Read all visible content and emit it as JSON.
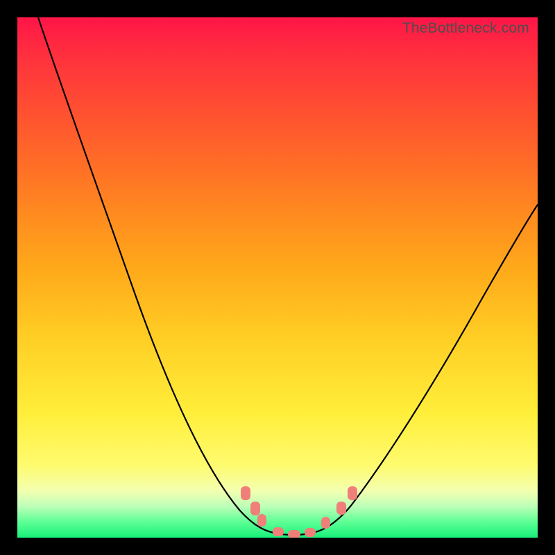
{
  "watermark": "TheBottleneck.com",
  "chart_data": {
    "type": "line",
    "title": "",
    "xlabel": "",
    "ylabel": "",
    "xlim": [
      0,
      100
    ],
    "ylim": [
      0,
      100
    ],
    "background": "rainbow-gradient-red-top-to-green-bottom",
    "series": [
      {
        "name": "bottleneck-curve",
        "x": [
          4,
          10,
          15,
          20,
          25,
          30,
          35,
          40,
          43,
          46,
          49,
          52,
          55,
          58,
          62,
          68,
          75,
          82,
          90,
          99
        ],
        "y": [
          100,
          84,
          72,
          60,
          48,
          36,
          25,
          15,
          9,
          5,
          2,
          1,
          1,
          2,
          5,
          12,
          23,
          35,
          48,
          62
        ],
        "note": "y is bottleneck percentage; 0 = no bottleneck (bottom, green), 100 = severe (top, red)"
      }
    ],
    "markers": [
      {
        "x": 43.5,
        "y": 9
      },
      {
        "x": 45.5,
        "y": 6
      },
      {
        "x": 47,
        "y": 4
      },
      {
        "x": 50,
        "y": 1.5
      },
      {
        "x": 53,
        "y": 1
      },
      {
        "x": 56,
        "y": 1.5
      },
      {
        "x": 59,
        "y": 3.5
      },
      {
        "x": 62,
        "y": 6
      },
      {
        "x": 64,
        "y": 9
      }
    ],
    "marker_style": {
      "color": "#ef8079",
      "shape": "rounded-dot"
    }
  }
}
